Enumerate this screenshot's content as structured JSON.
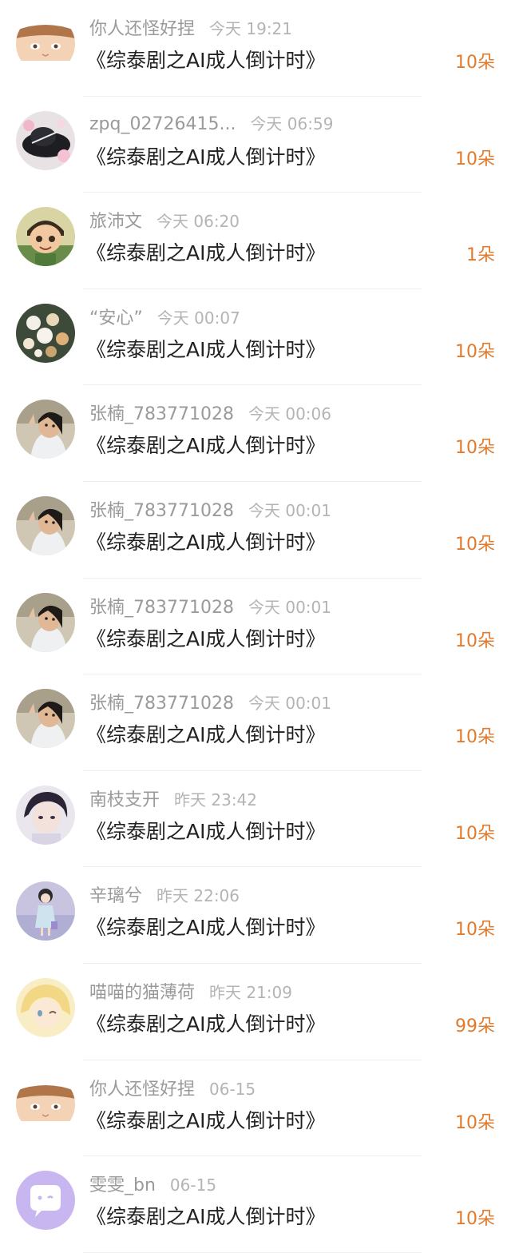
{
  "colors": {
    "gift_text": "#e07a2c",
    "username": "#9a9a9a",
    "time": "#b4b4b4",
    "title": "#222222"
  },
  "records": [
    {
      "user": "你人还怪好捏",
      "time": "今天 19:21",
      "title": "《综泰剧之AI成人倒计时》",
      "gift": "10朵",
      "avatar": "anime-boy"
    },
    {
      "user": "zpq_02726415...",
      "time": "今天 06:59",
      "title": "《综泰剧之AI成人倒计时》",
      "gift": "10朵",
      "avatar": "hat-flowers"
    },
    {
      "user": "旅沛文",
      "time": "今天 06:20",
      "title": "《综泰剧之AI成人倒计时》",
      "gift": "1朵",
      "avatar": "cartoon-boy"
    },
    {
      "user": "“安心”",
      "time": "今天 00:07",
      "title": "《综泰剧之AI成人倒计时》",
      "gift": "10朵",
      "avatar": "bouquet"
    },
    {
      "user": "张楠_783771028",
      "time": "今天 00:06",
      "title": "《综泰剧之AI成人倒计时》",
      "gift": "10朵",
      "avatar": "girl-photo"
    },
    {
      "user": "张楠_783771028",
      "time": "今天 00:01",
      "title": "《综泰剧之AI成人倒计时》",
      "gift": "10朵",
      "avatar": "girl-photo"
    },
    {
      "user": "张楠_783771028",
      "time": "今天 00:01",
      "title": "《综泰剧之AI成人倒计时》",
      "gift": "10朵",
      "avatar": "girl-photo"
    },
    {
      "user": "张楠_783771028",
      "time": "今天 00:01",
      "title": "《综泰剧之AI成人倒计时》",
      "gift": "10朵",
      "avatar": "girl-photo"
    },
    {
      "user": "南枝支开",
      "time": "昨天 23:42",
      "title": "《综泰剧之AI成人倒计时》",
      "gift": "10朵",
      "avatar": "anime-man"
    },
    {
      "user": "辛璃兮",
      "time": "昨天 22:06",
      "title": "《综泰剧之AI成人倒计时》",
      "gift": "10朵",
      "avatar": "cartoon-girl"
    },
    {
      "user": "喵喵的猫薄荷",
      "time": "昨天 21:09",
      "title": "《综泰剧之AI成人倒计时》",
      "gift": "99朵",
      "avatar": "blonde-anime"
    },
    {
      "user": "你人还怪好捏",
      "time": "06-15",
      "title": "《综泰剧之AI成人倒计时》",
      "gift": "10朵",
      "avatar": "anime-boy"
    },
    {
      "user": "雯雯_bn",
      "time": "06-15",
      "title": "《综泰剧之AI成人倒计时》",
      "gift": "10朵",
      "avatar": "chat-bubble"
    }
  ]
}
